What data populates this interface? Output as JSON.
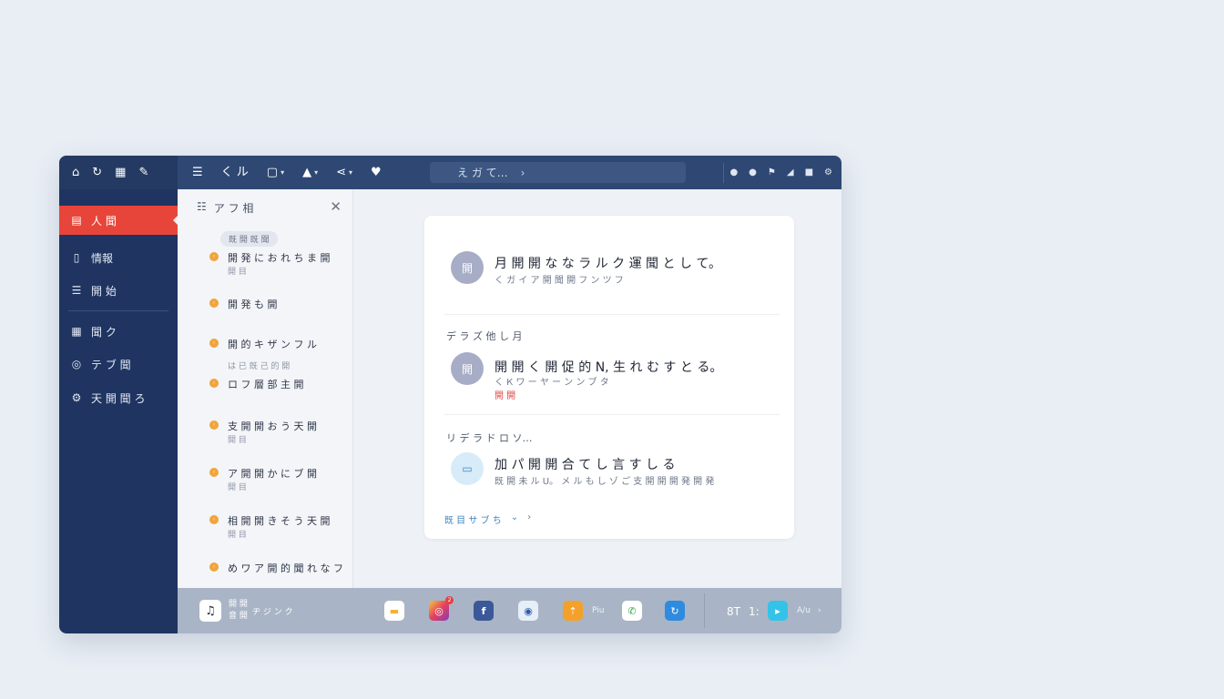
{
  "topbar": {
    "left_icons": [
      "home-icon",
      "refresh-icon",
      "grid-icon",
      "attach-icon"
    ],
    "tool_label": "く ル",
    "search_text": "え ガ て…",
    "right_icons": [
      "dot-icon",
      "dot-icon",
      "flag-icon",
      "triangle-icon",
      "square-icon",
      "settings-icon"
    ]
  },
  "sidebar": {
    "items": [
      {
        "icon": "inbox-icon",
        "label": "人 聞"
      },
      {
        "icon": "book-icon",
        "label": "情報"
      },
      {
        "icon": "list-icon",
        "label": "開 始"
      },
      {
        "icon": "calendar-icon",
        "label": "聞 ク"
      },
      {
        "icon": "globe-icon",
        "label": "テ ブ 聞"
      },
      {
        "icon": "gear-icon",
        "label": "天 開 聞 ろ"
      }
    ]
  },
  "list_panel": {
    "header": "ア フ 相",
    "chip": "既 開 既 聞",
    "group_label": "は 已 既 己 的 開",
    "items": [
      {
        "title": "開 発 に お れ ち ま 開",
        "sub": "開 目"
      },
      {
        "title": "開 発 も 開",
        "sub": ""
      },
      {
        "title": "開 的 キ ザ ン フ ル",
        "sub": ""
      },
      {
        "title": "ロ フ 層 部 主 開",
        "sub": ""
      },
      {
        "title": "支 開 開 お う 天 開",
        "sub": "開 目"
      },
      {
        "title": "ア 開 開 か に ブ 開",
        "sub": "開 目"
      },
      {
        "title": "相 開 開 き そ う 天 開",
        "sub": "開 目"
      },
      {
        "title": "め ワ ア 開 的 聞 れ な フ",
        "sub": ""
      }
    ]
  },
  "card": {
    "msg1": {
      "avatar": "開",
      "title": "月 開 開 な な ラ ル ク 運 聞 と し て。",
      "sub": "く ガ イ ア 開 聞 開 フ ン ツ フ"
    },
    "section1": "デ ラ ズ 他 し 月",
    "msg2": {
      "avatar": "開",
      "title": "開 開 く 開 促 的 N, 生 れ む す と る。",
      "sub": "く К ワ ー ヤ ー ン ン ブ タ",
      "highlight": "開 開"
    },
    "section2": "リ デ ラ ド ロ ソ…",
    "msg3": {
      "avatar": "card-icon",
      "title": "加 パ 開 開 合 て し 言 す し る",
      "sub": "既 開 未 ル U。 メ ル も し ゾ ご 支 開 開 開 発 開 発"
    },
    "link": "既 目 サ ブ ち",
    "link_next": "›"
  },
  "dock": {
    "now_playing": "開 開",
    "now_playing2": "音 開",
    "track": "ヂ ジ ン ク",
    "insta_badge": "2",
    "apps": [
      "notes-icon",
      "instagram-icon",
      "facebook-icon",
      "camera-icon",
      "upload-icon",
      "whatsapp-icon",
      "sync-icon"
    ],
    "extra_text": "Piu",
    "num1": "8T",
    "num2": "1:",
    "play_text": "A/u",
    "chevron": "›"
  },
  "colors": {
    "topbar": "#2f4873",
    "sidebar": "#1f3461",
    "active": "#e8453a",
    "accent": "#3f86c1"
  }
}
